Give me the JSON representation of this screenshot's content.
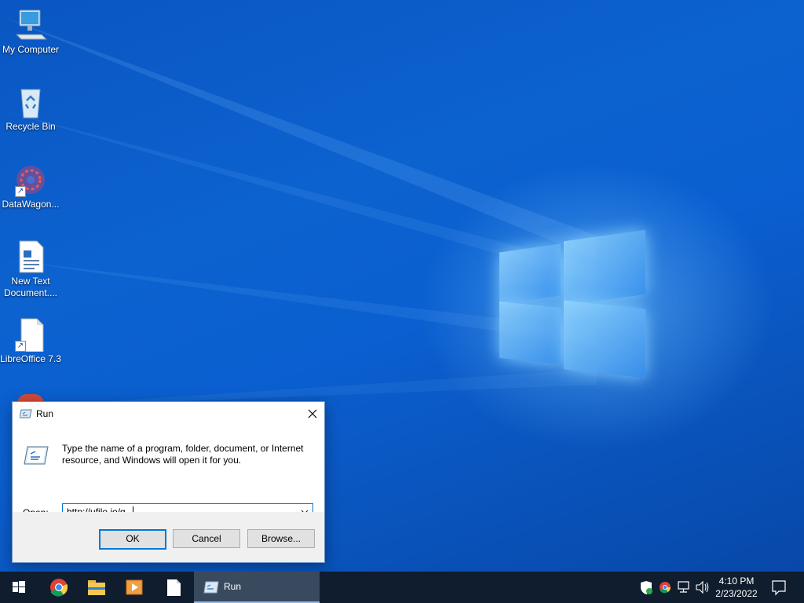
{
  "desktop": {
    "icons": [
      {
        "label": "My Computer"
      },
      {
        "label": "Recycle Bin"
      },
      {
        "label": "DataWagon..."
      },
      {
        "label": "New Text Document...."
      },
      {
        "label": "LibreOffice 7.3"
      }
    ]
  },
  "run_dialog": {
    "title": "Run",
    "description": "Type the name of a program, folder, document, or Internet resource, and Windows will open it for you.",
    "open_label": "Open:",
    "open_value": "http://ufile.io/g",
    "ok_label": "OK",
    "cancel_label": "Cancel",
    "browse_label": "Browse..."
  },
  "taskbar": {
    "active_window_label": "Run",
    "clock_time": "4:10 PM",
    "clock_date": "2/23/2022"
  },
  "colors": {
    "taskbar_bg": "#101d2e",
    "accent": "#0078d7"
  }
}
